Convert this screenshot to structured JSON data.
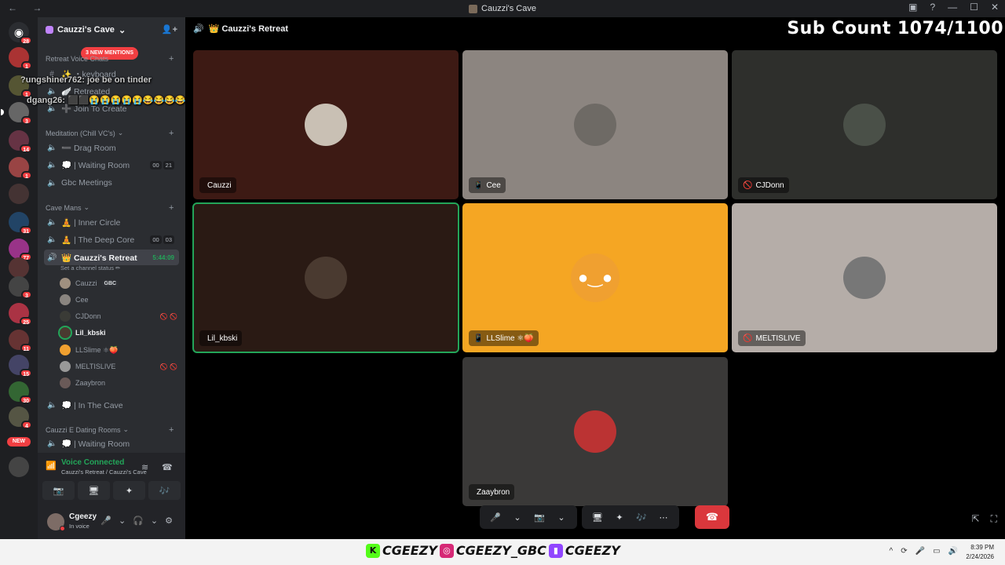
{
  "window": {
    "title": "Cauzzi's Cave"
  },
  "servers": {
    "badges": [
      "28",
      "1",
      "1",
      "3",
      "14",
      "1",
      "1",
      "31",
      "77",
      "3",
      "3",
      "25",
      "11",
      "15",
      "30",
      "4"
    ],
    "new_label": "NEW"
  },
  "sidebar": {
    "server_name": "Cauzzi's Cave",
    "new_mentions": "3 NEW MENTIONS",
    "categories": {
      "retreat": "Retreat Voice Chats",
      "meditation": "Meditation (Chill VC's)",
      "cave": "Cave Mans",
      "dating": "Cauzzi E Dating Rooms"
    },
    "channels": {
      "keyboard": "✨ ・keyboard",
      "retreated": "🪽 Retreated",
      "join": "➕ Join To Create",
      "drag": "➖ Drag Room",
      "waiting1": "💭 | Waiting Room",
      "waiting1_counts": [
        "00",
        "21"
      ],
      "gbc": "Gbc Meetings",
      "inner": "🧘 | Inner Circle",
      "deep": "🧘 | The Deep Core",
      "deep_counts": [
        "00",
        "03"
      ],
      "retreat": "👑 Cauzzi's Retreat",
      "retreat_time": "5:44:09",
      "status_hint": "Set a channel status ✏",
      "incave": "💭 | In The Cave",
      "waiting2": "💭 | Waiting Room"
    },
    "members": [
      {
        "name": "Cauzzi",
        "tag": "GBC"
      },
      {
        "name": "Cee"
      },
      {
        "name": "CJDonn"
      },
      {
        "name": "Lil_kbski"
      },
      {
        "name": "LLSlime ⚛🍑"
      },
      {
        "name": "MELTISLIVE"
      },
      {
        "name": "Zaaybron"
      }
    ]
  },
  "chat_overlay": [
    {
      "user": "?ungshiner762:",
      "msg": "joe be on tinder"
    },
    {
      "user": "dgang26:",
      "msg": "⬛⬛😭😭😭😭😭😂😂😂😂😂😂"
    }
  ],
  "voice": {
    "connected": "Voice Connected",
    "location": "Cauzzi's Retreat / Cauzzi's Cave"
  },
  "user": {
    "name": "Cgeezy",
    "status": "In voice"
  },
  "main": {
    "channel_title": "👑 Cauzzi's Retreat",
    "sub_count": "Sub Count 1074/1100",
    "tiles": [
      {
        "name": "Cauzzi",
        "icon": ""
      },
      {
        "name": "Cee",
        "icon": "📱"
      },
      {
        "name": "CJDonn",
        "icon": "🚫"
      },
      {
        "name": "Lil_kbski",
        "icon": ""
      },
      {
        "name": "LLSlime ⚛🍑",
        "icon": "📱"
      },
      {
        "name": "MELTISLIVE",
        "icon": "🚫"
      },
      {
        "name": "Zaaybron",
        "icon": ""
      }
    ],
    "tile_colors": [
      "#3d1a14",
      "#8c8580",
      "#2e2f2c",
      "#2a1a14",
      "#f5a623",
      "#b5ada8",
      "#3a3938"
    ]
  },
  "taskbar": {
    "brand": [
      "CGEEZY",
      "CGEEZY_GBC",
      "CGEEZY"
    ],
    "time": "8:39 PM",
    "date": "2/24/2026"
  },
  "colors": {
    "accent_green": "#23a559",
    "danger": "#da373c",
    "sidebar_bg": "#2b2d31"
  }
}
